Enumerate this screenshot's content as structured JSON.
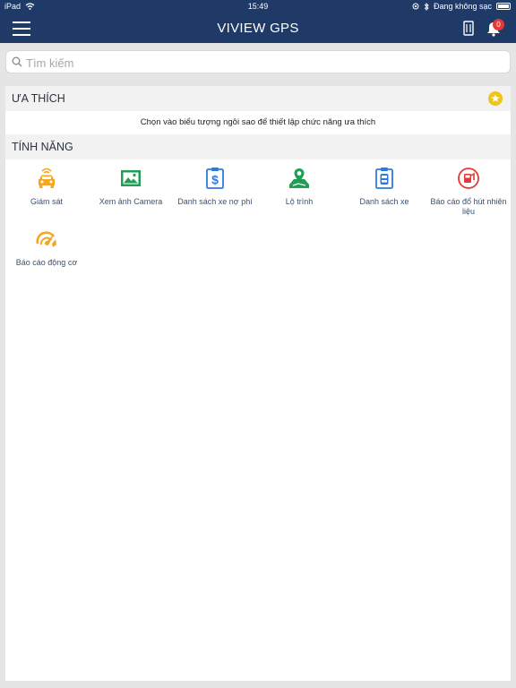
{
  "status_bar": {
    "device": "iPad",
    "time": "15:49",
    "charging_text": "Đang không sạc"
  },
  "header": {
    "title": "VIVIEW GPS",
    "notification_count": "0"
  },
  "search": {
    "placeholder": "Tìm kiếm"
  },
  "favorites": {
    "title": "ƯA THÍCH",
    "hint": "Chọn vào biểu tượng ngôi sao để thiết lập chức năng ưa thích"
  },
  "features": {
    "title": "TÍNH NĂNG",
    "items": [
      {
        "label": "Giám sát",
        "icon": "car-monitor-icon",
        "color": "#f5a623"
      },
      {
        "label": "Xem ảnh Camera",
        "icon": "camera-image-icon",
        "color": "#1e9e57"
      },
      {
        "label": "Danh sách xe nợ phí",
        "icon": "fee-debt-list-icon",
        "color": "#2c7be5"
      },
      {
        "label": "Lộ trình",
        "icon": "route-map-icon",
        "color": "#1e9e57"
      },
      {
        "label": "Danh sách xe",
        "icon": "vehicle-list-icon",
        "color": "#2c7be5"
      },
      {
        "label": "Báo cáo đổ hút nhiên liệu",
        "icon": "fuel-report-icon",
        "color": "#e53935"
      },
      {
        "label": "Báo cáo động cơ",
        "icon": "engine-report-icon",
        "color": "#f5a623"
      }
    ]
  },
  "colors": {
    "header_bg": "#1f3a66",
    "label_text": "#3b5173",
    "star": "#f0c419"
  }
}
